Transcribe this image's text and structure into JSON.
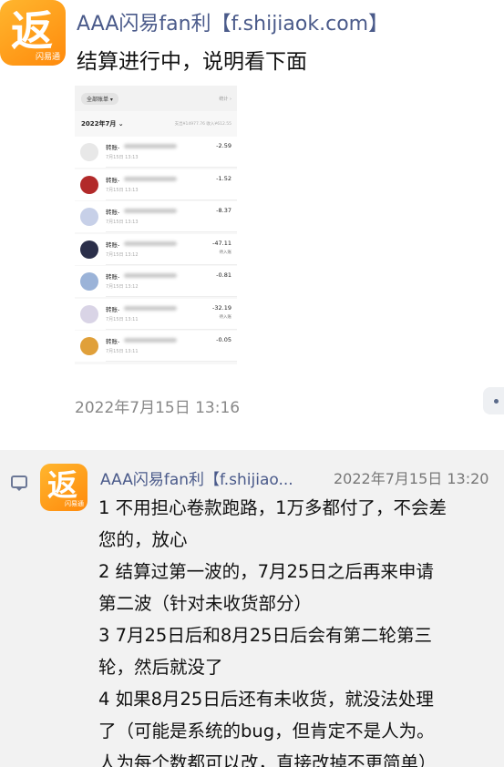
{
  "top_message": {
    "avatar": {
      "glyph": "返",
      "sub_label": "闪易通"
    },
    "sender": "AAA闪易fan利【f.shijiaok.com】",
    "text": "结算进行中，说明看下面",
    "timestamp": "2022年7月15日 13:16"
  },
  "screenshot": {
    "filter_label": "全部账单 ▾",
    "stats_label": "统计 ›",
    "month_label": "2022年7月 ⌄",
    "summary": "支出¥14977.76  收入¥612.55",
    "transactions": [
      {
        "title": "转账-",
        "date": "7月15日 13:13",
        "amount": "-2.59",
        "note": "",
        "icon_color": "#e8e8e8"
      },
      {
        "title": "转账-",
        "date": "7月15日 13:13",
        "amount": "-1.52",
        "note": "",
        "icon_color": "#b22a2a"
      },
      {
        "title": "转账-",
        "date": "7月15日 13:13",
        "amount": "-8.37",
        "note": "",
        "icon_color": "#c7d0e8"
      },
      {
        "title": "转账-",
        "date": "7月15日 13:12",
        "amount": "-47.11",
        "note": "待入账",
        "icon_color": "#2b2f4a"
      },
      {
        "title": "转账-",
        "date": "7月15日 13:12",
        "amount": "-0.81",
        "note": "",
        "icon_color": "#9bb3d8"
      },
      {
        "title": "转账-",
        "date": "7月15日 13:11",
        "amount": "-32.19",
        "note": "待入账",
        "icon_color": "#d9d4e6"
      },
      {
        "title": "转账-",
        "date": "7月15日 13:11",
        "amount": "-0.05",
        "note": "",
        "icon_color": "#e0a03a"
      }
    ]
  },
  "quoted_message": {
    "avatar": {
      "glyph": "返",
      "sub_label": "闪易通"
    },
    "sender": "AAA闪易fan利【f.shijiao...",
    "timestamp": "2022年7月15日 13:20",
    "lines": [
      "1  不用担心卷款跑路，1万多都付了，不会差",
      "您的，放心",
      "2  结算过第一波的，7月25日之后再来申请",
      "第二波（针对未收货部分）",
      "3  7月25日后和8月25日后会有第二轮第三",
      "轮，然后就没了",
      "4  如果8月25日后还有未收货，就没法处理",
      "了（可能是系统的bug，但肯定不是人为。",
      "人为每个数都可以改，直接改掉不更简单）"
    ]
  },
  "colors": {
    "avatar_orange": "#ff9a1f",
    "sender_blue": "#4a5a8a",
    "quote_background": "#f2f2f2"
  }
}
